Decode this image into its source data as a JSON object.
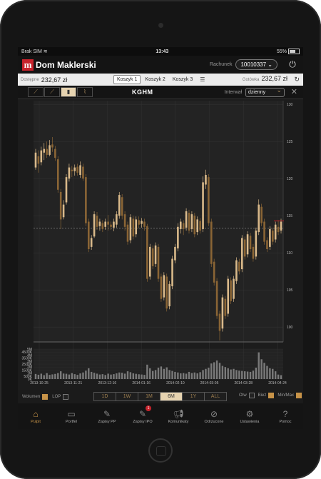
{
  "status": {
    "carrier": "Brak SIM",
    "time": "13:43",
    "battery": "55%"
  },
  "app": {
    "logo_letter": "m",
    "logo_text": "Dom Maklerski",
    "account_label": "Rachunek",
    "account_value": "10010337"
  },
  "cash": {
    "available_label": "Dostępne",
    "available_value": "232,67 zł",
    "cash_label": "Gotówka",
    "cash_value": "232,67 zł"
  },
  "baskets": [
    "Koszyk 1",
    "Koszyk 2",
    "Koszyk 3"
  ],
  "chart_toolbar": {
    "ticker": "KGHM",
    "interval_label": "Interwał",
    "interval_value": "dzienny"
  },
  "range_buttons": [
    "1D",
    "1W",
    "1M",
    "6M",
    "1Y",
    "ALL"
  ],
  "active_range": "6M",
  "toggles": {
    "volume": "Wolumen",
    "lop": "LOP",
    "otw": "Otw",
    "biez": "Bież",
    "minmax": "Min/Max"
  },
  "tabs": [
    {
      "label": "Pulpit",
      "icon": "home-icon"
    },
    {
      "label": "Portfel",
      "icon": "wallet-icon"
    },
    {
      "label": "Zapisy PP",
      "icon": "document-edit-icon"
    },
    {
      "label": "Zapisy IPO",
      "icon": "document-edit-icon",
      "badge": "1"
    },
    {
      "label": "Komunikaty",
      "icon": "megaphone-icon"
    },
    {
      "label": "Odrzucone",
      "icon": "rejected-icon"
    },
    {
      "label": "Ustawienia",
      "icon": "gear-icon"
    },
    {
      "label": "Pomoc",
      "icon": "help-icon"
    }
  ],
  "chart_data": [
    {
      "type": "candlestick",
      "title": "KGHM",
      "x_tick_labels": [
        "2013-10-25",
        "2013-11-21",
        "2013-12-16",
        "2014-01-16",
        "2014-02-10",
        "2014-03-05",
        "2014-03-28",
        "2014-04-24"
      ],
      "y_tick_labels": [
        "130",
        "125",
        "120",
        "115",
        "110",
        "105",
        "100"
      ],
      "ylim": [
        98,
        130.5
      ],
      "reference_line": 113.3,
      "points": [
        [
          0,
          121.5,
          123.5,
          121.2,
          124.0
        ],
        [
          1,
          123.0,
          122.0,
          120.8,
          123.8
        ],
        [
          2,
          122.2,
          123.8,
          121.8,
          124.3
        ],
        [
          3,
          123.5,
          124.0,
          122.5,
          124.8
        ],
        [
          4,
          124.0,
          123.2,
          122.8,
          125.0
        ],
        [
          5,
          123.2,
          124.5,
          123.0,
          125.2
        ],
        [
          6,
          124.6,
          124.2,
          123.6,
          125.6
        ],
        [
          7,
          124.0,
          122.8,
          122.4,
          124.4
        ],
        [
          8,
          122.6,
          118.5,
          118.1,
          123.0
        ],
        [
          9,
          118.2,
          114.5,
          113.2,
          118.6
        ],
        [
          10,
          114.8,
          116.5,
          114.5,
          117.1
        ],
        [
          11,
          116.8,
          120.2,
          116.5,
          120.6
        ],
        [
          12,
          120.0,
          121.5,
          119.6,
          122.0
        ],
        [
          13,
          121.2,
          121.0,
          120.2,
          121.7
        ],
        [
          14,
          121.0,
          121.5,
          120.4,
          121.9
        ],
        [
          15,
          121.6,
          120.8,
          120.4,
          122.0
        ],
        [
          16,
          120.5,
          121.8,
          120.1,
          122.3
        ],
        [
          17,
          121.6,
          120.0,
          119.7,
          122.0
        ],
        [
          18,
          120.2,
          114.0,
          113.6,
          120.6
        ],
        [
          19,
          114.2,
          110.5,
          110.1,
          114.6
        ],
        [
          20,
          110.8,
          112.0,
          110.4,
          112.4
        ],
        [
          21,
          112.2,
          115.2,
          112.0,
          115.6
        ],
        [
          22,
          115.0,
          113.5,
          113.1,
          115.5
        ],
        [
          23,
          113.6,
          114.2,
          113.0,
          114.6
        ],
        [
          24,
          114.0,
          113.2,
          112.8,
          114.4
        ],
        [
          25,
          113.5,
          114.2,
          113.1,
          114.6
        ],
        [
          26,
          114.2,
          113.8,
          113.0,
          115.1
        ],
        [
          27,
          113.8,
          113.5,
          113.1,
          114.2
        ],
        [
          28,
          113.4,
          114.2,
          112.9,
          114.6
        ],
        [
          29,
          113.8,
          115.2,
          113.4,
          115.6
        ],
        [
          30,
          115.0,
          117.8,
          114.6,
          118.2
        ],
        [
          31,
          117.5,
          115.0,
          114.5,
          117.9
        ],
        [
          32,
          115.2,
          113.5,
          113.0,
          115.6
        ],
        [
          33,
          113.8,
          111.5,
          111.1,
          114.2
        ],
        [
          34,
          111.7,
          114.8,
          111.3,
          115.2
        ],
        [
          35,
          114.6,
          112.2,
          111.8,
          115.0
        ],
        [
          36,
          112.5,
          114.5,
          112.1,
          114.9
        ],
        [
          37,
          114.4,
          113.8,
          113.3,
          114.9
        ],
        [
          38,
          113.9,
          114.3,
          113.4,
          114.7
        ],
        [
          39,
          114.2,
          113.5,
          113.0,
          114.6
        ],
        [
          40,
          113.6,
          106.5,
          106.1,
          113.9
        ],
        [
          41,
          106.8,
          110.8,
          106.4,
          111.2
        ],
        [
          42,
          110.6,
          108.2,
          107.8,
          111.0
        ],
        [
          43,
          108.5,
          111.0,
          108.1,
          111.4
        ],
        [
          44,
          110.8,
          106.5,
          106.1,
          111.2
        ],
        [
          45,
          106.8,
          103.8,
          103.4,
          107.2
        ],
        [
          46,
          104.0,
          107.0,
          103.6,
          107.4
        ],
        [
          47,
          106.8,
          102.5,
          102.1,
          107.2
        ],
        [
          48,
          102.8,
          105.8,
          102.4,
          106.2
        ],
        [
          49,
          105.5,
          109.2,
          105.1,
          109.6
        ],
        [
          50,
          109.0,
          110.8,
          108.6,
          111.2
        ],
        [
          51,
          110.6,
          113.5,
          110.2,
          114.0
        ],
        [
          52,
          113.2,
          114.2,
          112.6,
          114.6
        ],
        [
          53,
          114.0,
          113.2,
          112.4,
          114.4
        ],
        [
          54,
          113.4,
          115.6,
          113.0,
          116.0
        ],
        [
          55,
          115.4,
          113.0,
          112.6,
          115.8
        ],
        [
          56,
          113.2,
          115.2,
          112.8,
          115.6
        ],
        [
          57,
          115.0,
          112.5,
          112.1,
          115.4
        ],
        [
          58,
          112.8,
          114.5,
          112.4,
          114.9
        ],
        [
          59,
          114.3,
          113.0,
          112.6,
          114.7
        ],
        [
          60,
          113.2,
          119.5,
          112.8,
          120.3
        ],
        [
          61,
          119.2,
          120.5,
          118.6,
          121.2
        ],
        [
          62,
          120.2,
          114.0,
          113.6,
          120.6
        ],
        [
          63,
          114.2,
          108.5,
          108.1,
          114.6
        ],
        [
          64,
          108.8,
          106.0,
          105.6,
          109.2
        ],
        [
          65,
          106.2,
          101.5,
          101.1,
          106.6
        ],
        [
          66,
          101.8,
          99.5,
          98.2,
          102.2
        ],
        [
          67,
          99.8,
          104.0,
          99.4,
          104.4
        ],
        [
          68,
          103.8,
          101.5,
          101.1,
          104.2
        ],
        [
          69,
          101.8,
          106.5,
          101.4,
          106.9
        ],
        [
          70,
          106.3,
          103.5,
          103.1,
          106.7
        ],
        [
          71,
          103.8,
          106.5,
          103.4,
          106.9
        ],
        [
          72,
          106.2,
          109.0,
          105.8,
          109.4
        ],
        [
          73,
          108.8,
          107.5,
          107.1,
          109.2
        ],
        [
          74,
          107.8,
          112.0,
          107.4,
          112.4
        ],
        [
          75,
          111.8,
          109.5,
          109.1,
          112.2
        ],
        [
          76,
          109.8,
          112.5,
          109.4,
          112.9
        ],
        [
          77,
          112.3,
          110.5,
          110.1,
          112.7
        ],
        [
          78,
          110.8,
          109.2,
          108.8,
          111.2
        ],
        [
          79,
          109.5,
          113.0,
          109.1,
          113.4
        ],
        [
          80,
          112.8,
          116.5,
          112.4,
          117.2
        ],
        [
          81,
          116.2,
          114.0,
          113.6,
          116.6
        ],
        [
          82,
          114.2,
          111.5,
          111.1,
          114.6
        ],
        [
          83,
          111.7,
          110.5,
          110.1,
          112.1
        ],
        [
          84,
          110.8,
          113.2,
          110.4,
          113.6
        ],
        [
          85,
          113.0,
          111.5,
          111.1,
          113.4
        ],
        [
          86,
          111.8,
          113.8,
          111.4,
          114.2
        ],
        [
          87,
          113.5,
          112.8,
          112.4,
          114.4
        ],
        [
          88,
          113.0,
          114.2,
          112.6,
          114.6
        ]
      ],
      "volume_axis_labels": [
        "5M",
        "4500K",
        "4M",
        "3500K",
        "3M",
        "2500K",
        "2M",
        "1500K",
        "1M",
        "500K",
        "0K"
      ],
      "volume": [
        850,
        720,
        900,
        650,
        980,
        700,
        780,
        860,
        1000,
        1300,
        920,
        880,
        760,
        990,
        820,
        700,
        940,
        1100,
        1400,
        1800,
        1200,
        1050,
        900,
        760,
        820,
        680,
        900,
        750,
        820,
        950,
        1100,
        1050,
        900,
        1300,
        1150,
        950,
        870,
        800,
        760,
        700,
        2400,
        1800,
        1350,
        1500,
        1900,
        2100,
        1700,
        1950,
        1500,
        1350,
        1200,
        1100,
        950,
        1000,
        900,
        1200,
        1000,
        1100,
        950,
        1150,
        1500,
        1700,
        1900,
        2600,
        2800,
        3100,
        2700,
        2200,
        2000,
        1800,
        1600,
        1700,
        1500,
        1400,
        1350,
        1300,
        1250,
        1200,
        1400,
        1900,
        4450,
        3300,
        2700,
        2200,
        1800,
        1700,
        1300,
        750,
        650
      ],
      "volume_ylim": [
        0,
        5000
      ]
    }
  ]
}
